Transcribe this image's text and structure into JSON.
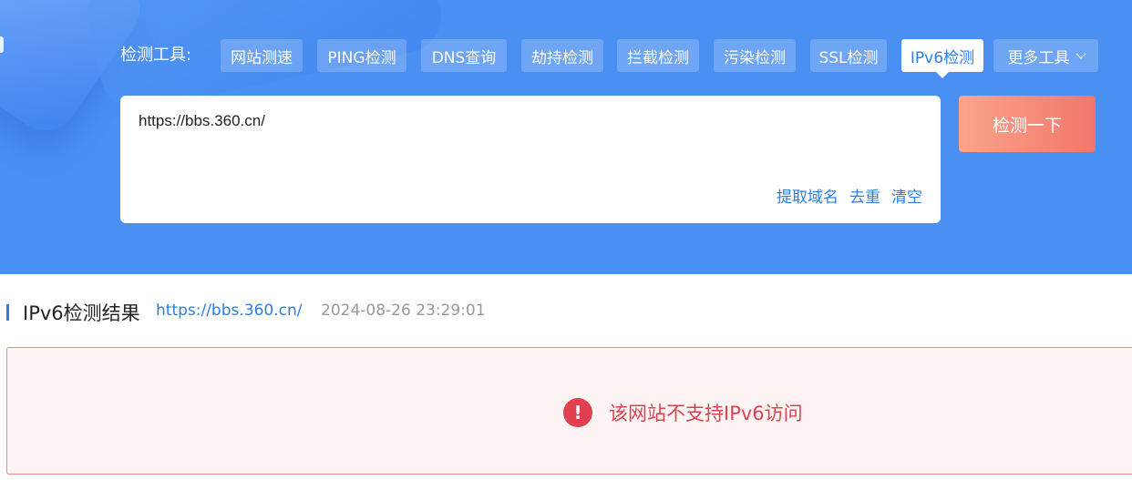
{
  "toolbar": {
    "label": "检测工具:",
    "tabs": [
      {
        "label": "网站测速"
      },
      {
        "label": "PING检测"
      },
      {
        "label": "DNS查询"
      },
      {
        "label": "劫持检测"
      },
      {
        "label": "拦截检测"
      },
      {
        "label": "污染检测"
      },
      {
        "label": "SSL检测"
      },
      {
        "label": "IPv6检测",
        "active": true
      },
      {
        "label": "更多工具"
      }
    ]
  },
  "input": {
    "value": "https://bbs.360.cn/",
    "extract_label": "提取域名",
    "dedupe_label": "去重",
    "clear_label": "清空"
  },
  "check_button": {
    "label": "检测一下"
  },
  "result": {
    "title": "IPv6检测结果",
    "url": "https://bbs.360.cn/",
    "timestamp": "2024-08-26 23:29:01",
    "message": "该网站不支持IPv6访问",
    "status_icon": "error-icon"
  },
  "colors": {
    "hero_blue": "#4a8ff2",
    "link_blue": "#2b7de9",
    "button_start": "#fca48a",
    "button_end": "#f0776b",
    "error_red": "#d9434f",
    "error_bg": "#fff4f4"
  }
}
